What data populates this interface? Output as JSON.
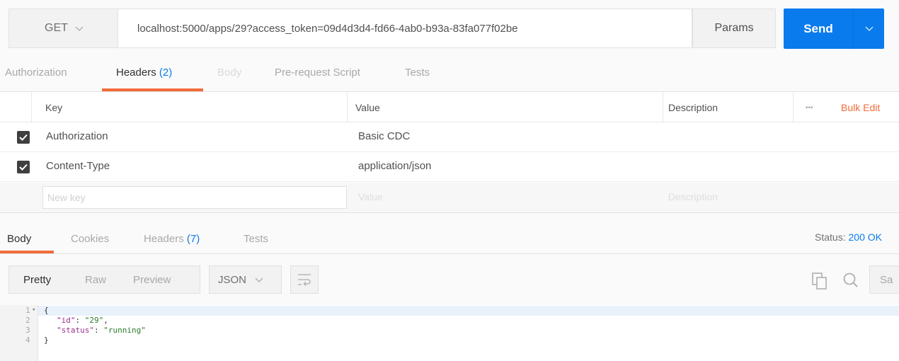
{
  "request": {
    "method": "GET",
    "url": "localhost:5000/apps/29?access_token=09d4d3d4-fd66-4ab0-b93a-83fa077f02be",
    "params_label": "Params",
    "send_label": "Send"
  },
  "request_tabs": {
    "authorization": "Authorization",
    "headers_label": "Headers",
    "headers_count": "(2)",
    "body": "Body",
    "prerequest": "Pre-request Script",
    "tests": "Tests"
  },
  "headers_table": {
    "col_key": "Key",
    "col_value": "Value",
    "col_description": "Description",
    "more_label": "•••",
    "bulk_edit": "Bulk Edit",
    "rows": [
      {
        "key": "Authorization",
        "value": "Basic CDC",
        "checked": true
      },
      {
        "key": "Content-Type",
        "value": "application/json",
        "checked": true
      }
    ],
    "new_key_placeholder": "New key",
    "new_value_placeholder": "Value",
    "new_description_placeholder": "Description"
  },
  "response_tabs": {
    "body": "Body",
    "cookies": "Cookies",
    "headers_label": "Headers",
    "headers_count": "(7)",
    "tests": "Tests",
    "status_label": "Status:",
    "status_value": "200 OK"
  },
  "response_toolbar": {
    "pretty": "Pretty",
    "raw": "Raw",
    "preview": "Preview",
    "format": "JSON",
    "save_partial": "Sa"
  },
  "response_body": {
    "line_numbers": [
      "1",
      "2",
      "3",
      "4"
    ],
    "open_brace": "{",
    "close_brace": "}",
    "fields": [
      {
        "key": "\"id\"",
        "value": "\"29\"",
        "trail": ","
      },
      {
        "key": "\"status\"",
        "value": "\"running\"",
        "trail": ""
      }
    ]
  },
  "colors": {
    "accent_blue": "#097bed",
    "tab_underline": "#f26b3a",
    "bulk_edit": "#f26b3a"
  }
}
